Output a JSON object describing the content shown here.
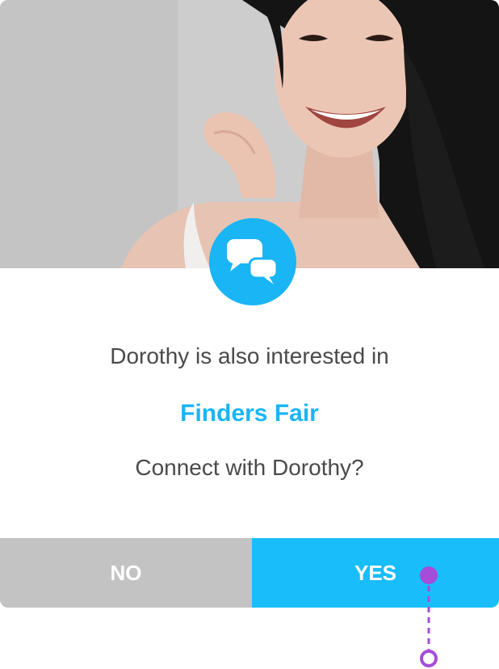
{
  "card": {
    "photo_alt": "Profile photo of Dorothy",
    "badge_icon": "chat-bubbles-icon",
    "message_line1": "Dorothy is also interested in",
    "event_name": "Finders Fair",
    "message_line3": "Connect with Dorothy?"
  },
  "actions": {
    "no_label": "NO",
    "yes_label": "YES"
  },
  "colors": {
    "accent": "#19b5f5",
    "no_button": "#c3c3c3",
    "yes_button": "#19bdf9",
    "touch_indicator": "#a54cd8"
  }
}
